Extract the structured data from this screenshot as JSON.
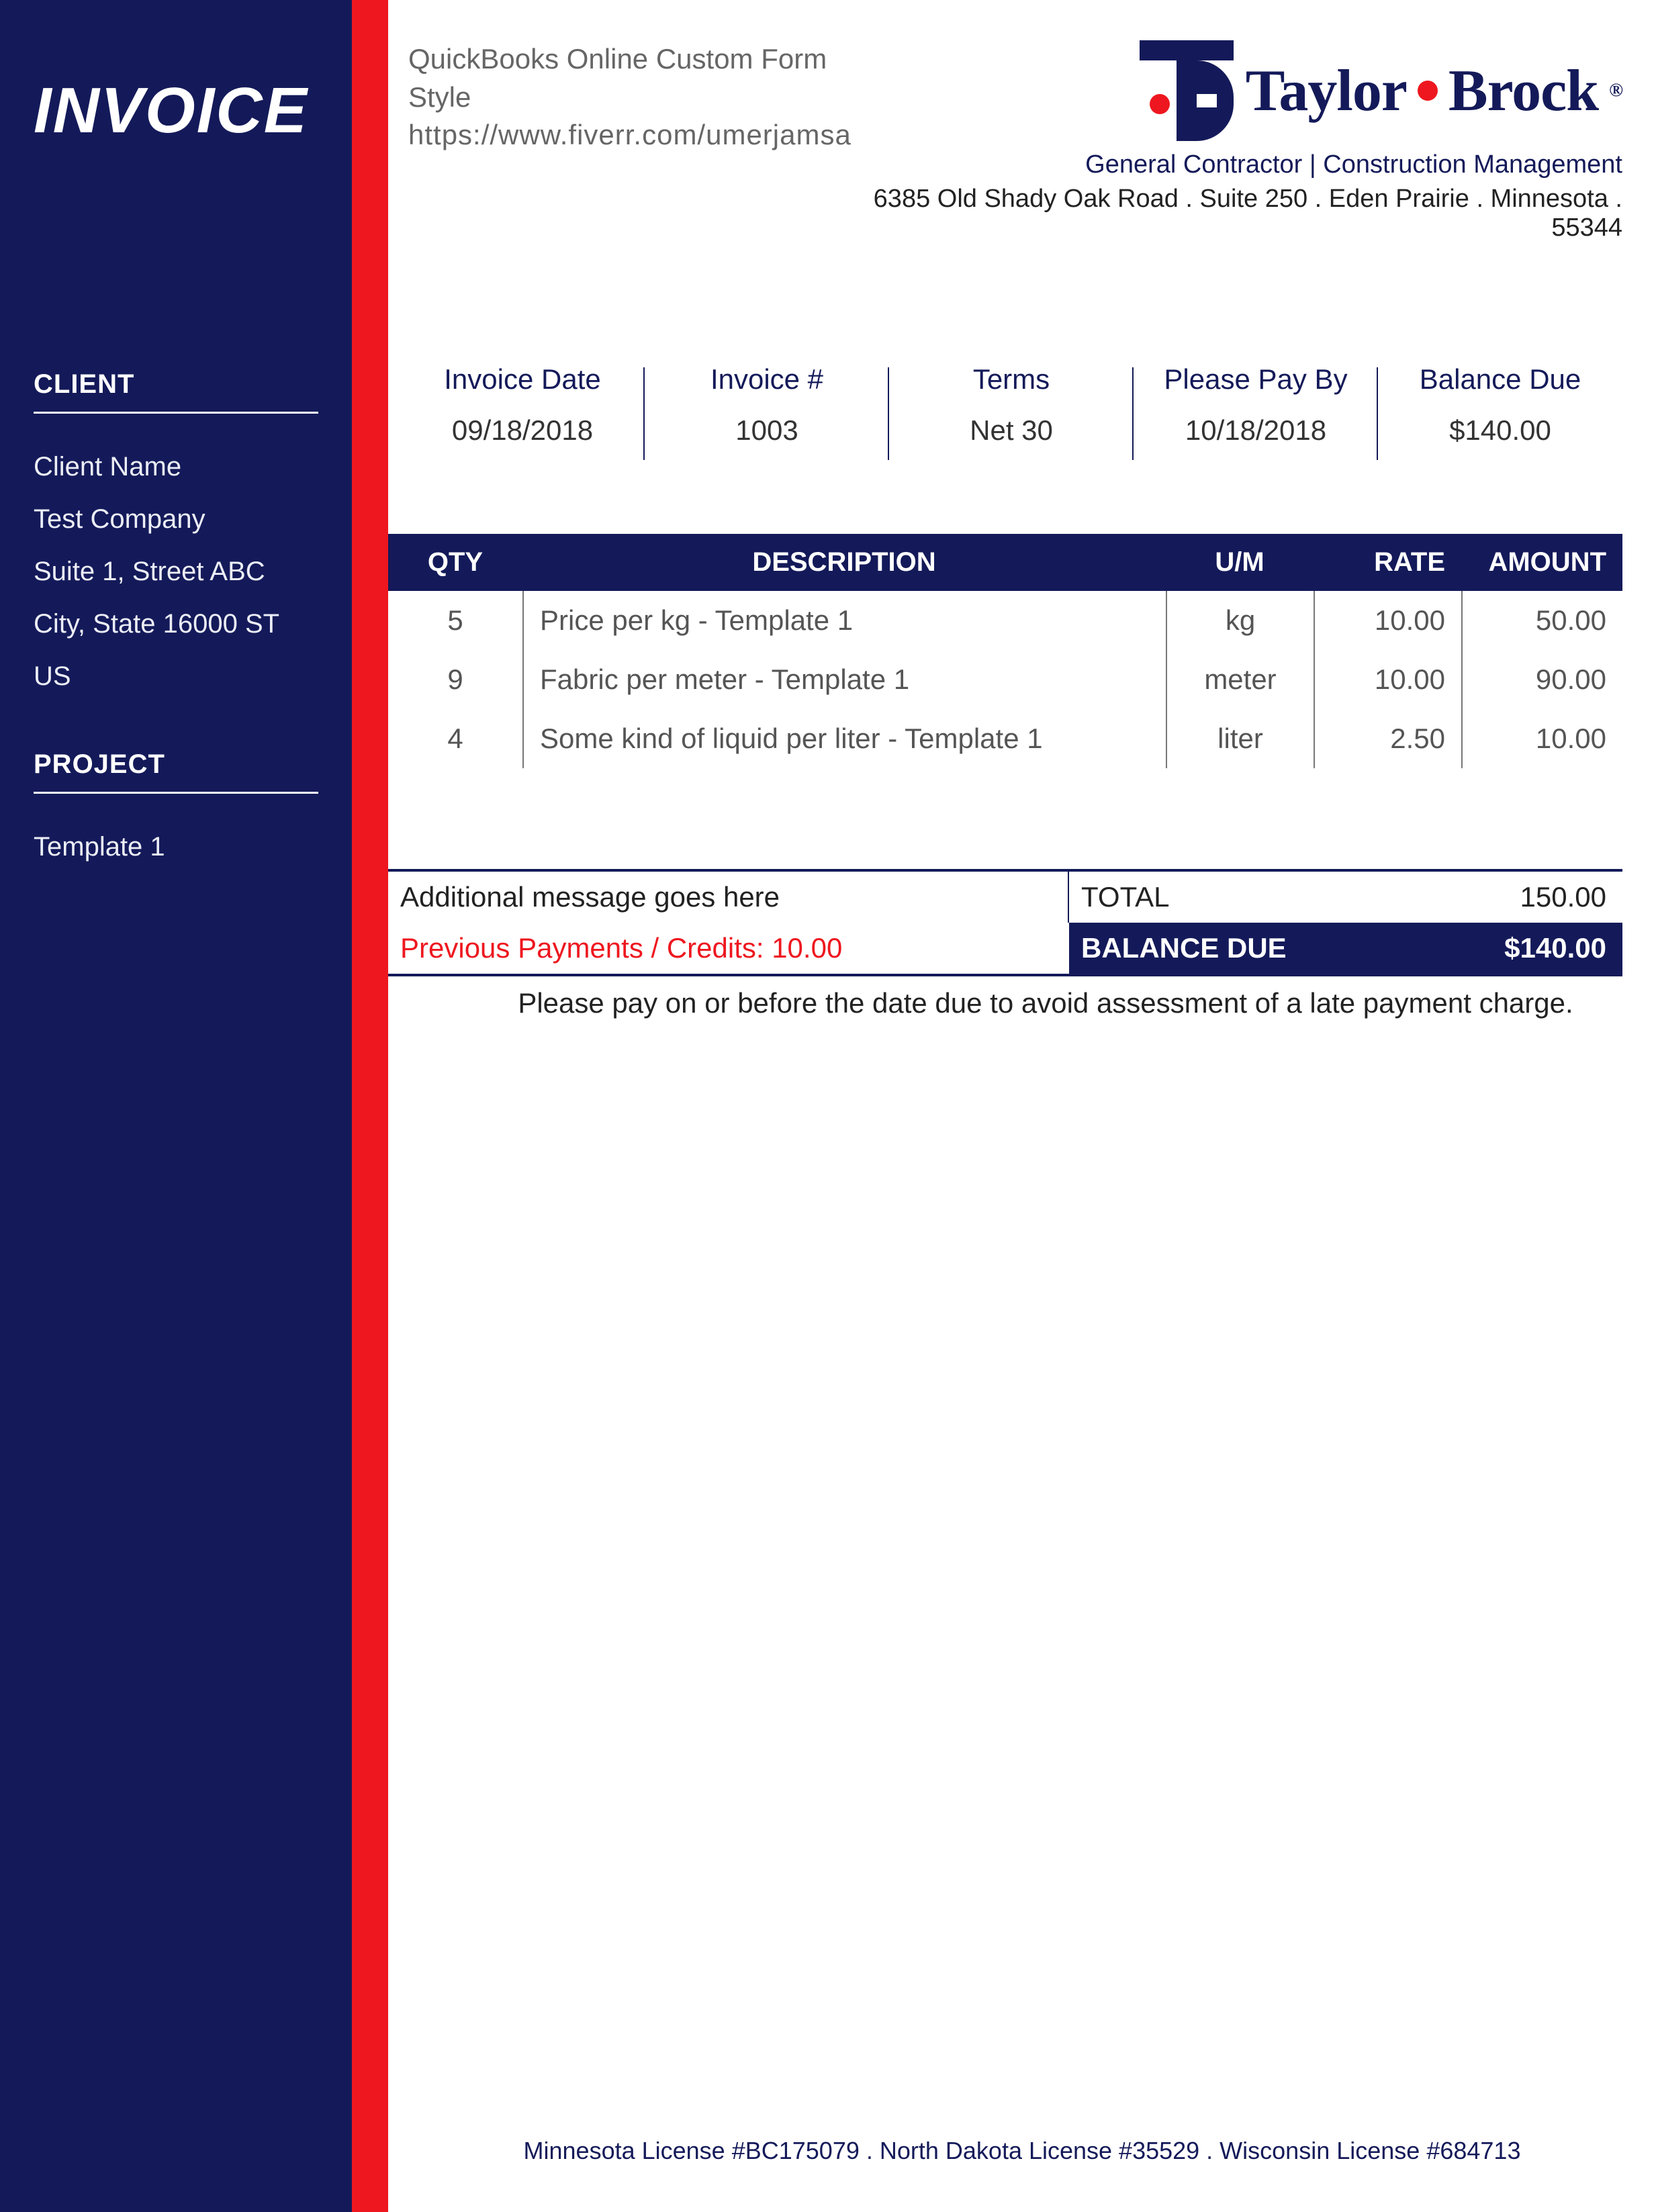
{
  "doc_title": "INVOICE",
  "header": {
    "line1": "QuickBooks Online Custom Form Style",
    "line2": "https://www.fiverr.com/umerjamsa",
    "brand_name_part1": "Taylor",
    "brand_name_part2": "Brock",
    "brand_reg": "®",
    "tagline": "General Contractor | Construction Management",
    "address": "6385 Old Shady Oak Road . Suite 250 . Eden Prairie . Minnesota . 55344"
  },
  "client": {
    "heading": "CLIENT",
    "name": "Client Name",
    "company": "Test Company",
    "street": "Suite 1, Street ABC",
    "city_line": "City, State   16000 ST US"
  },
  "project": {
    "heading": "PROJECT",
    "name": "Template 1"
  },
  "meta": {
    "cols": [
      {
        "label": "Invoice Date",
        "value": "09/18/2018"
      },
      {
        "label": "Invoice #",
        "value": "1003"
      },
      {
        "label": "Terms",
        "value": "Net 30"
      },
      {
        "label": "Please Pay By",
        "value": "10/18/2018"
      },
      {
        "label": "Balance Due",
        "value": "$140.00"
      }
    ]
  },
  "table": {
    "headers": {
      "qty": "QTY",
      "desc": "DESCRIPTION",
      "um": "U/M",
      "rate": "RATE",
      "amount": "AMOUNT"
    },
    "rows": [
      {
        "qty": "5",
        "desc": "Price per kg - Template 1",
        "um": "kg",
        "rate": "10.00",
        "amount": "50.00"
      },
      {
        "qty": "9",
        "desc": "Fabric per meter - Template 1",
        "um": "meter",
        "rate": "10.00",
        "amount": "90.00"
      },
      {
        "qty": "4",
        "desc": "Some kind of liquid per liter - Template 1",
        "um": "liter",
        "rate": "2.50",
        "amount": "10.00"
      }
    ]
  },
  "totals": {
    "message": "Additional message goes here",
    "total_label": "TOTAL",
    "total_value": "150.00",
    "credits": "Previous Payments / Credits: 10.00",
    "balance_label": "BALANCE DUE",
    "balance_value": "$140.00"
  },
  "note": "Please pay on or before the date due to avoid assessment of a late payment charge.",
  "footer": "Minnesota License #BC175079 . North Dakota License #35529 . Wisconsin License #684713"
}
